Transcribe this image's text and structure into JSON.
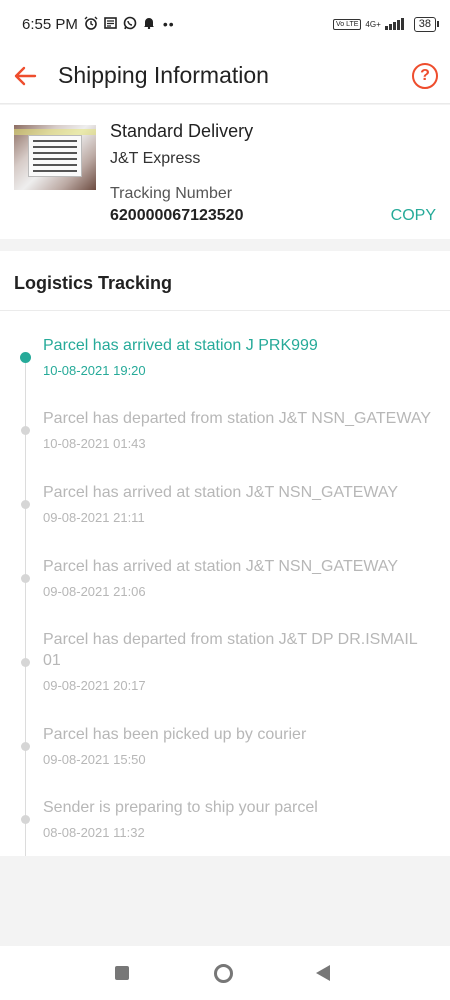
{
  "status_bar": {
    "time": "6:55 PM",
    "icons": [
      "alarm-icon",
      "news-icon",
      "whatsapp-icon",
      "notification-bell-icon"
    ],
    "more": "••",
    "volte": "Vo LTE",
    "network": "4G+",
    "battery": "38"
  },
  "header": {
    "title": "Shipping Information",
    "help": "?"
  },
  "shipment": {
    "method": "Standard Delivery",
    "carrier": "J&T Express",
    "tracking_label": "Tracking Number",
    "tracking_number": "620000067123520",
    "copy_label": "COPY"
  },
  "tracking": {
    "title": "Logistics Tracking",
    "events": [
      {
        "description": "Parcel has arrived at station J PRK999",
        "time": "10-08-2021 19:20",
        "active": true
      },
      {
        "description": "Parcel has departed from station J&T NSN_GATEWAY",
        "time": "10-08-2021 01:43",
        "active": false
      },
      {
        "description": "Parcel has arrived at station J&T NSN_GATEWAY",
        "time": "09-08-2021 21:11",
        "active": false
      },
      {
        "description": "Parcel has arrived at station J&T NSN_GATEWAY",
        "time": "09-08-2021 21:06",
        "active": false
      },
      {
        "description": "Parcel has departed from station J&T DP DR.ISMAIL 01",
        "time": "09-08-2021 20:17",
        "active": false
      },
      {
        "description": "Parcel has been picked up by courier",
        "time": "09-08-2021 15:50",
        "active": false
      },
      {
        "description": "Sender is preparing to ship your parcel",
        "time": "08-08-2021 11:32",
        "active": false
      }
    ]
  },
  "colors": {
    "accent": "#ee4d2d",
    "active": "#26aa99",
    "inactive": "#b7b7b7"
  }
}
